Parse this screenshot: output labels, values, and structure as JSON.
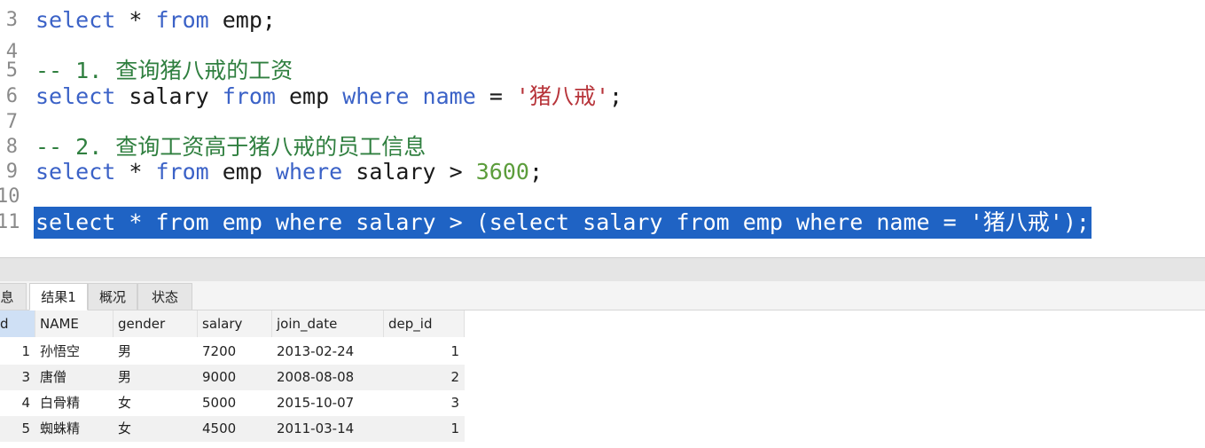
{
  "editor": {
    "lines": [
      {
        "num": "3",
        "tokens": [
          [
            "kw",
            "select"
          ],
          [
            "tx",
            " * "
          ],
          [
            "kw",
            "from"
          ],
          [
            "tx",
            " emp;"
          ]
        ]
      },
      {
        "num": "4",
        "tokens": []
      },
      {
        "num": "5",
        "tokens": [
          [
            "cm",
            "-- 1. 查询猪八戒的工资"
          ]
        ]
      },
      {
        "num": "6",
        "tokens": [
          [
            "kw",
            "select"
          ],
          [
            "tx",
            " salary "
          ],
          [
            "kw",
            "from"
          ],
          [
            "tx",
            " emp "
          ],
          [
            "kw",
            "where"
          ],
          [
            "tx",
            " "
          ],
          [
            "kw",
            "name"
          ],
          [
            "tx",
            " = "
          ],
          [
            "st",
            "'猪八戒'"
          ],
          [
            "tx",
            ";"
          ]
        ]
      },
      {
        "num": "7",
        "tokens": []
      },
      {
        "num": "8",
        "tokens": [
          [
            "cm",
            "-- 2. 查询工资高于猪八戒的员工信息"
          ]
        ]
      },
      {
        "num": "9",
        "tokens": [
          [
            "kw",
            "select"
          ],
          [
            "tx",
            " * "
          ],
          [
            "kw",
            "from"
          ],
          [
            "tx",
            " emp "
          ],
          [
            "kw",
            "where"
          ],
          [
            "tx",
            " salary > "
          ],
          [
            "nm",
            "3600"
          ],
          [
            "tx",
            ";"
          ]
        ]
      },
      {
        "num": "10",
        "tokens": []
      },
      {
        "num": "11",
        "selected": true,
        "tokens": [
          [
            "kw",
            "select"
          ],
          [
            "tx",
            " * "
          ],
          [
            "kw",
            "from"
          ],
          [
            "tx",
            " emp "
          ],
          [
            "kw",
            "where"
          ],
          [
            "tx",
            " salary > ("
          ],
          [
            "kw",
            "select"
          ],
          [
            "tx",
            " salary "
          ],
          [
            "kw",
            "from"
          ],
          [
            "tx",
            " emp "
          ],
          [
            "kw",
            "where"
          ],
          [
            "tx",
            " "
          ],
          [
            "kw",
            "name"
          ],
          [
            "tx",
            " = "
          ],
          [
            "st",
            "'猪八戒'"
          ],
          [
            "tx",
            ");"
          ]
        ]
      }
    ]
  },
  "tabs": [
    {
      "label": "息",
      "active": false
    },
    {
      "label": "结果1",
      "active": true
    },
    {
      "label": "概况",
      "active": false
    },
    {
      "label": "状态",
      "active": false
    }
  ],
  "result": {
    "columns": [
      "d",
      "NAME",
      "gender",
      "salary",
      "join_date",
      "dep_id"
    ],
    "rows": [
      [
        "1",
        "孙悟空",
        "男",
        "7200",
        "2013-02-24",
        "1"
      ],
      [
        "3",
        "唐僧",
        "男",
        "9000",
        "2008-08-08",
        "2"
      ],
      [
        "4",
        "白骨精",
        "女",
        "5000",
        "2015-10-07",
        "3"
      ],
      [
        "5",
        "蜘蛛精",
        "女",
        "4500",
        "2011-03-14",
        "1"
      ]
    ]
  },
  "colors": {
    "keyword": "#3b62c7",
    "comment": "#2f7f3f",
    "string": "#b7343a",
    "number": "#5c9d3c",
    "selection": "#1f63c4"
  }
}
